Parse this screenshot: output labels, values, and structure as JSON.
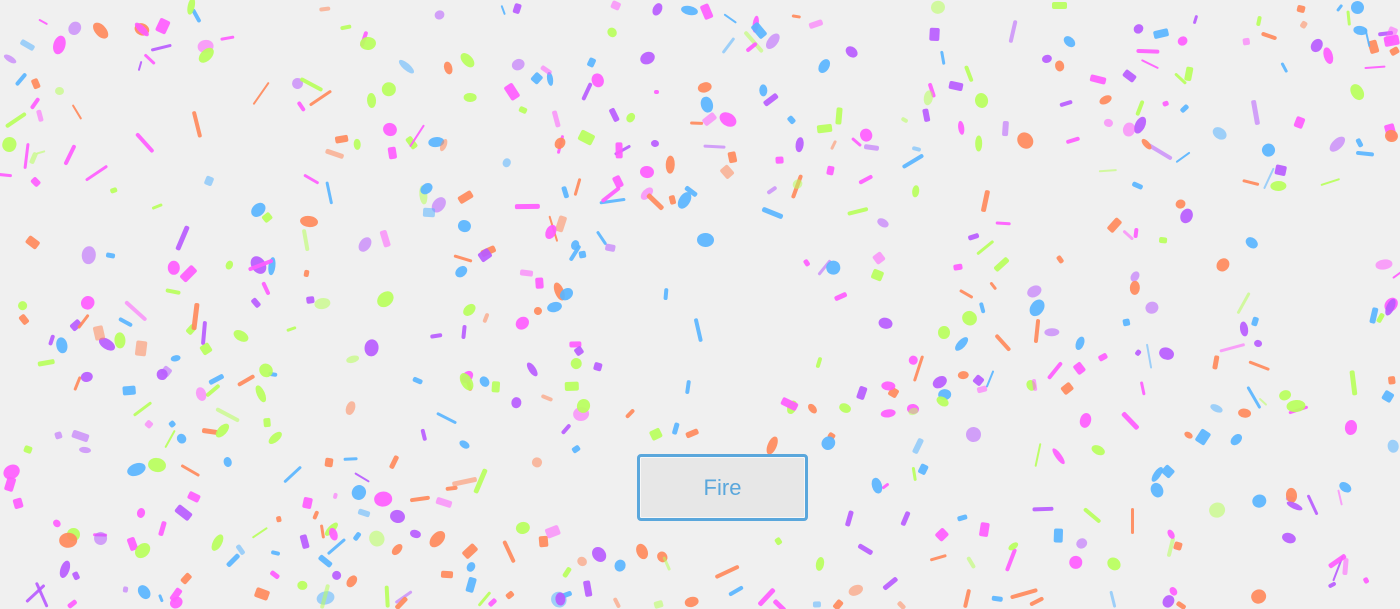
{
  "app": {
    "button_label": "Fire"
  },
  "visual": {
    "background": "#f0f0f0",
    "confetti_colors": [
      "#ff5cff",
      "#b85cff",
      "#5ab5ff",
      "#ff8a5c",
      "#b8ff5c"
    ]
  }
}
